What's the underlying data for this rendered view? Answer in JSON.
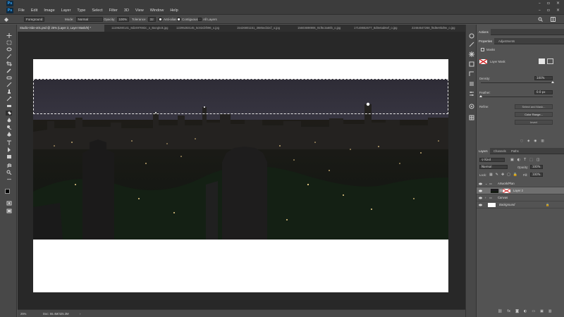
{
  "app": {
    "logo": "Ps",
    "menu": [
      "File",
      "Edit",
      "Image",
      "Layer",
      "Type",
      "Select",
      "Filter",
      "3D",
      "View",
      "Window",
      "Help"
    ],
    "window_controls": [
      "–",
      "▫",
      "×"
    ]
  },
  "options": {
    "sample_mode": "Foreground",
    "mode_label": "Mode:",
    "mode_value": "Normal",
    "opacity_label": "Opacity:",
    "opacity_value": "100%",
    "tolerance_label": "Tolerance:",
    "tolerance_value": "32",
    "anti_alias": "Anti-alias",
    "contiguous": "Contiguous",
    "all_layers": "All Layers"
  },
  "tabs": [
    {
      "label": "Studio-Vide-o01.psd @ 25% (Layer 2, Layer Mask/8) *",
      "active": true
    },
    {
      "label": "11196280141_8d2497692c_o_Bangkok.jpg",
      "active": false
    },
    {
      "label": "12295283145_5c82cbf096_o.jpg",
      "active": false
    },
    {
      "label": "15426801151_3685ed32cf_o.jpg",
      "active": false
    },
    {
      "label": "15603698906_91f6c3a60b_o.jpg",
      "active": false
    },
    {
      "label": "17148652677_8d0e6ab6ef_o.jpg",
      "active": false
    },
    {
      "label": "22464647268_f8d6e9bd9e_o.jpg",
      "active": false
    }
  ],
  "status": {
    "zoom": "25%",
    "doc": "Doc: 55.4M/425.3M"
  },
  "panels": {
    "actions": "Actions",
    "properties_tab": "Properties",
    "adjustments_tab": "Adjustments",
    "masks_label": "Masks",
    "layer_mask_label": "Layer Mask",
    "density_label": "Density:",
    "density_value": "100%",
    "density_level": 1.0,
    "feather_label": "Feather:",
    "feather_value": "0.0 px",
    "feather_level": 0.0,
    "refine_label": "Refine:",
    "select_mask_button": "Select and Mask...",
    "color_range_button": "Color Range...",
    "invert_button": "Invert"
  },
  "layers": {
    "tabs": [
      "Layers",
      "Channels",
      "Paths"
    ],
    "kind_label": "Kind",
    "blend_mode": "Normal",
    "opacity_label": "Opacity:",
    "opacity_value": "100%",
    "lock_label": "Lock:",
    "fill_label": "Fill:",
    "fill_value": "100%",
    "items": [
      {
        "name": "Artwork/Plan",
        "type": "group",
        "selected": false
      },
      {
        "name": "Layer 2",
        "type": "layer-mask",
        "selected": true
      },
      {
        "name": "Canvas",
        "type": "group",
        "selected": false
      },
      {
        "name": "Background",
        "type": "background",
        "selected": false
      }
    ]
  },
  "colors": {
    "accent": "#33a8ff",
    "panel": "#535353",
    "canvas_bg": "#282828"
  }
}
